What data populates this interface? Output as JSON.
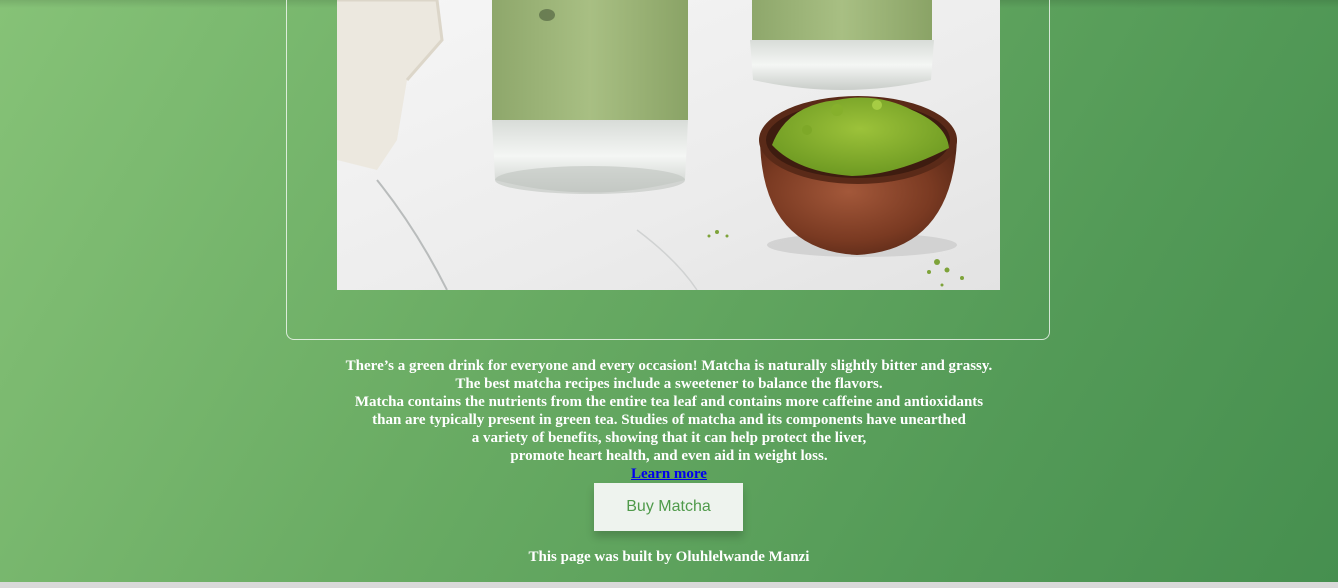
{
  "hero": {
    "image_alt": "Matcha latte glasses with a wooden bowl of matcha powder"
  },
  "description": {
    "lines": [
      "There’s a green drink for everyone and every occasion! Matcha is naturally slightly bitter and grassy.",
      "The best matcha recipes include a sweetener to balance the flavors.",
      "Matcha contains the nutrients from the entire tea leaf and contains more caffeine and antioxidants",
      "than are typically present in green tea. Studies of matcha and its components have unearthed",
      "a variety of benefits, showing that it can help protect the liver,",
      "promote heart health, and even aid in weight loss."
    ],
    "learn_more": "Learn more"
  },
  "buy_button": {
    "label": "Buy Matcha"
  },
  "footer": {
    "credit": "This page was built by Oluhlelwande Manzi"
  },
  "colors": {
    "background_start": "#86c277",
    "background_end": "#468f4f",
    "button_text": "#4f9a4a",
    "link": "#0000ee"
  }
}
